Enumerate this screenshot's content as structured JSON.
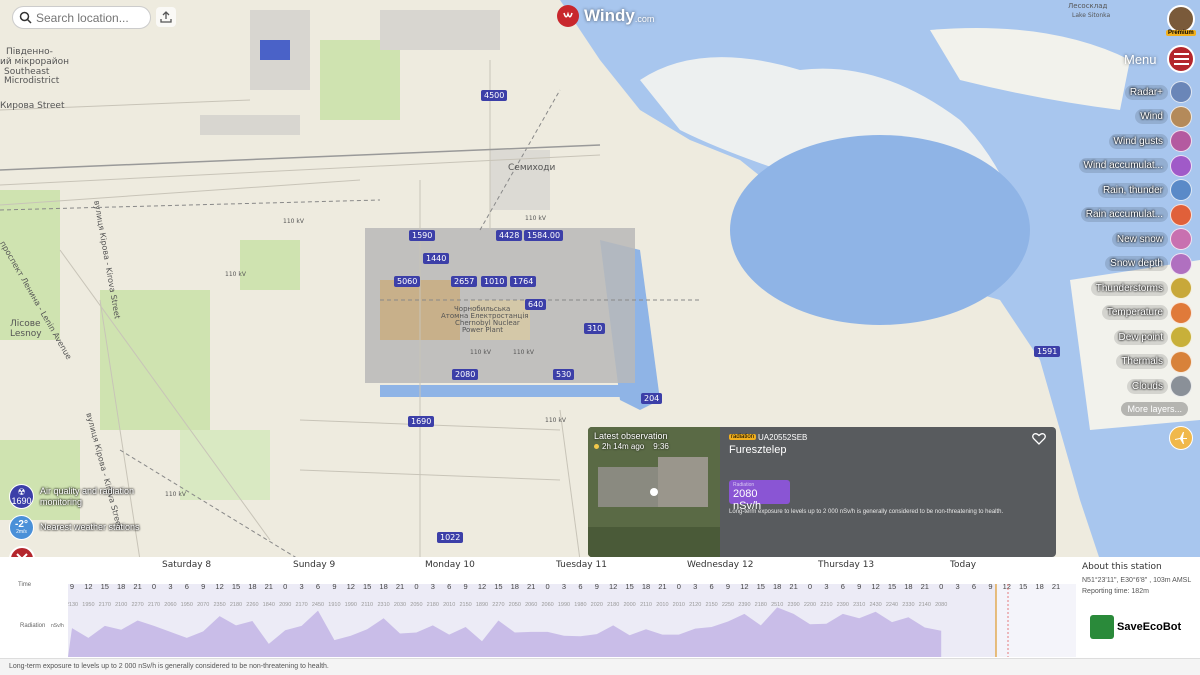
{
  "search": {
    "placeholder": "Search location..."
  },
  "logo": {
    "name": "Windy",
    "suffix": ".com"
  },
  "account": {
    "badge": "Premium"
  },
  "menu": {
    "label": "Menu"
  },
  "layers": [
    {
      "label": "Radar+",
      "color": "#6a86b8"
    },
    {
      "label": "Wind",
      "color": "#b48a5a"
    },
    {
      "label": "Wind gusts",
      "color": "#b45aa0"
    },
    {
      "label": "Wind accumulat...",
      "color": "#a05ac8"
    },
    {
      "label": "Rain, thunder",
      "color": "#5a8ac8"
    },
    {
      "label": "Rain accumulat...",
      "color": "#e0603a"
    },
    {
      "label": "New snow",
      "color": "#c870b0"
    },
    {
      "label": "Snow depth",
      "color": "#b070c0"
    },
    {
      "label": "Thunderstorms",
      "color": "#c8a83a"
    },
    {
      "label": "Temperature",
      "color": "#e07a3a"
    },
    {
      "label": "Dew point",
      "color": "#c8b03a"
    },
    {
      "label": "Thermals",
      "color": "#d8823a"
    },
    {
      "label": "Clouds",
      "color": "#8a9098"
    }
  ],
  "more_layers": "More layers...",
  "left_controls": {
    "radiation_value": "1690",
    "radiation_label": "Air quality and radiation monitoring",
    "weather_value": "-2°",
    "weather_sub": "2m/s",
    "weather_label": "Nearest weather stations"
  },
  "map": {
    "place_labels": [
      "Південно-",
      "ий мікрорайон",
      "Southeast",
      "Microdistrict",
      "Кирова Street",
      "Семиходи",
      "Лісове",
      "Lesnoy",
      "проспект Ленина - Lenin Avenue",
      "вулиця Кірова - Kirova Street",
      "вулиця Кірова - Kirova Street",
      "Чорнобильська",
      "Атомна Електростанція",
      "Chernobyl Nuclear",
      "Power Plant",
      "110 kV",
      "110 kV",
      "110 kV",
      "110 kV",
      "110 kV",
      "110 kV",
      "110 kV",
      "Лесосклад",
      "Lake Sitonka"
    ],
    "radiation_badges": [
      "4500",
      "1590",
      "4428",
      "1584.00",
      "1440",
      "5060",
      "2657",
      "1010",
      "1764",
      "640",
      "310",
      "2080",
      "530",
      "204",
      "1690",
      "1022",
      "1591"
    ]
  },
  "popup": {
    "latest_obs": "Latest observation",
    "ago": "2h 14m ago",
    "time": "9:36",
    "tag": "radiation",
    "station_id": "UA20552SEB",
    "name": "Furesztelep",
    "value_label": "Radiation",
    "value": "2080 nSv/h",
    "note": "Long-term exposure to levels up to 2 000 nSv/h is generally considered to be non-threatening to health."
  },
  "timeline": {
    "days": [
      "Saturday 8",
      "Sunday 9",
      "Monday 10",
      "Tuesday 11",
      "Wednesday 12",
      "Thursday 13",
      "Today"
    ],
    "row_time": "Time",
    "row_radiation": "Radiation",
    "unit": "nSv/h",
    "hours": [
      "9",
      "12",
      "15",
      "18",
      "21",
      "0",
      "3",
      "6",
      "9",
      "12",
      "15",
      "18",
      "21",
      "0",
      "3",
      "6",
      "9",
      "12",
      "15",
      "18",
      "21",
      "0",
      "3",
      "6",
      "9",
      "12",
      "15",
      "18",
      "21",
      "0",
      "3",
      "6",
      "9",
      "12",
      "15",
      "18",
      "21",
      "0",
      "3",
      "6",
      "9",
      "12",
      "15",
      "18",
      "21",
      "0",
      "3",
      "6",
      "9",
      "12",
      "15",
      "18",
      "21",
      "0",
      "3",
      "6",
      "9",
      "12",
      "15",
      "18",
      "21"
    ],
    "values": [
      "2130",
      "1950",
      "2170",
      "2100",
      "2270",
      "2170",
      "2060",
      "1950",
      "2070",
      "2350",
      "2180",
      "2260",
      "1840",
      "2090",
      "2170",
      "2450",
      "1910",
      "1990",
      "2110",
      "2310",
      "2030",
      "2050",
      "2180",
      "2010",
      "2150",
      "1890",
      "2270",
      "2050",
      "2060",
      "2060",
      "1990",
      "1980",
      "2020",
      "2180",
      "2000",
      "2110",
      "2010",
      "2010",
      "2120",
      "2150",
      "2250",
      "2390",
      "2180",
      "2510",
      "2390",
      "2200",
      "2210",
      "2390",
      "2310",
      "2430",
      "2240",
      "2330",
      "2140",
      "2080"
    ],
    "station_title": "About this station",
    "station_coords": "N51°23'11\", E30°6'8\" , 103m AMSL",
    "reporting_time": "Reporting time: 182m",
    "partner": "SaveEcoBot"
  },
  "footer": {
    "note": "Long-term exposure to levels up to 2 000 nSv/h is generally considered to be non-threatening to health."
  },
  "colors": {
    "accent": "#b4262c",
    "radiation": "#8a55d4",
    "water": "#9cbde8"
  }
}
